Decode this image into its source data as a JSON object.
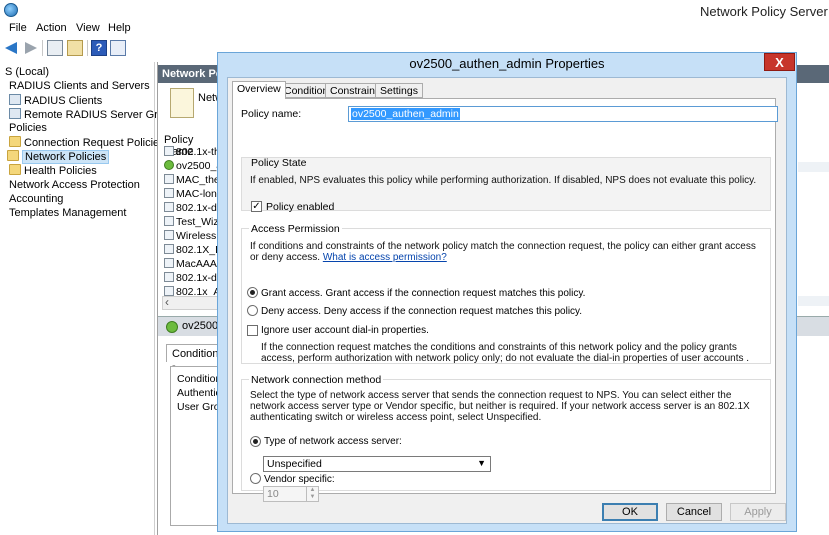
{
  "app": {
    "title": "Network Policy Server"
  },
  "menu": [
    "File",
    "Action",
    "View",
    "Help"
  ],
  "tree": {
    "root": "S (Local)",
    "items": [
      {
        "label": "RADIUS Clients and Servers"
      },
      {
        "label": "RADIUS Clients"
      },
      {
        "label": "Remote RADIUS Server Groups"
      },
      {
        "label": "Policies"
      },
      {
        "label": "Connection Request Policies"
      },
      {
        "label": "Network Policies"
      },
      {
        "label": "Health Policies"
      },
      {
        "label": "Network Access Protection"
      },
      {
        "label": "Accounting"
      },
      {
        "label": "Templates Management"
      }
    ]
  },
  "content": {
    "header": "Network Pol",
    "intro": "Netw",
    "list_header": "Policy Name",
    "policies": [
      "802.1x-thea",
      "ov2500_au",
      "MAC_thean",
      "MAC-long",
      "802.1x-duc",
      "Test_Wizar",
      "Wireless M",
      "802.1X_Du",
      "MacAAA",
      "802.1x-dem",
      "802.1x_Anl"
    ],
    "detail_header": "ov2500_a",
    "detail_tab": "Conditions -",
    "conditions": [
      "Condition",
      "Authentica",
      "User Group"
    ]
  },
  "dialog": {
    "title": "ov2500_authen_admin Properties",
    "close_label": "X",
    "tabs": [
      "Overview",
      "Conditions",
      "Constraints",
      "Settings"
    ],
    "policy_name_label": "Policy name:",
    "policy_name_value": "ov2500_authen_admin",
    "policy_state": {
      "title": "Policy State",
      "description": "If enabled, NPS evaluates this policy while performing authorization. If disabled, NPS does not evaluate this policy.",
      "enabled_label": "Policy enabled",
      "enabled": true
    },
    "access_permission": {
      "title": "Access Permission",
      "description": "If conditions and constraints of the network policy match the connection request, the policy can either grant access or deny access.",
      "link": "What is access permission?",
      "grant_label": "Grant access. Grant access if the connection request matches this policy.",
      "deny_label": "Deny access. Deny access if the connection request matches this policy.",
      "selected": "grant",
      "ignore_label": "Ignore user account dial-in properties.",
      "ignore_checked": false,
      "ignore_description": "If the connection request matches the conditions and constraints of this network policy and the policy grants access, perform authorization with network policy only; do not evaluate the dial-in properties of user accounts ."
    },
    "network_connection": {
      "title": "Network connection method",
      "description": "Select the type of network access server that sends the connection request to NPS. You can select either the network access server type or Vendor specific, but neither is required.  If your network access server is an 802.1X authenticating switch or wireless access point, select Unspecified.",
      "type_label": "Type of network access server:",
      "type_value": "Unspecified",
      "vendor_label": "Vendor specific:",
      "vendor_value": "10",
      "selected": "type"
    },
    "buttons": {
      "ok": "OK",
      "cancel": "Cancel",
      "apply": "Apply"
    }
  }
}
